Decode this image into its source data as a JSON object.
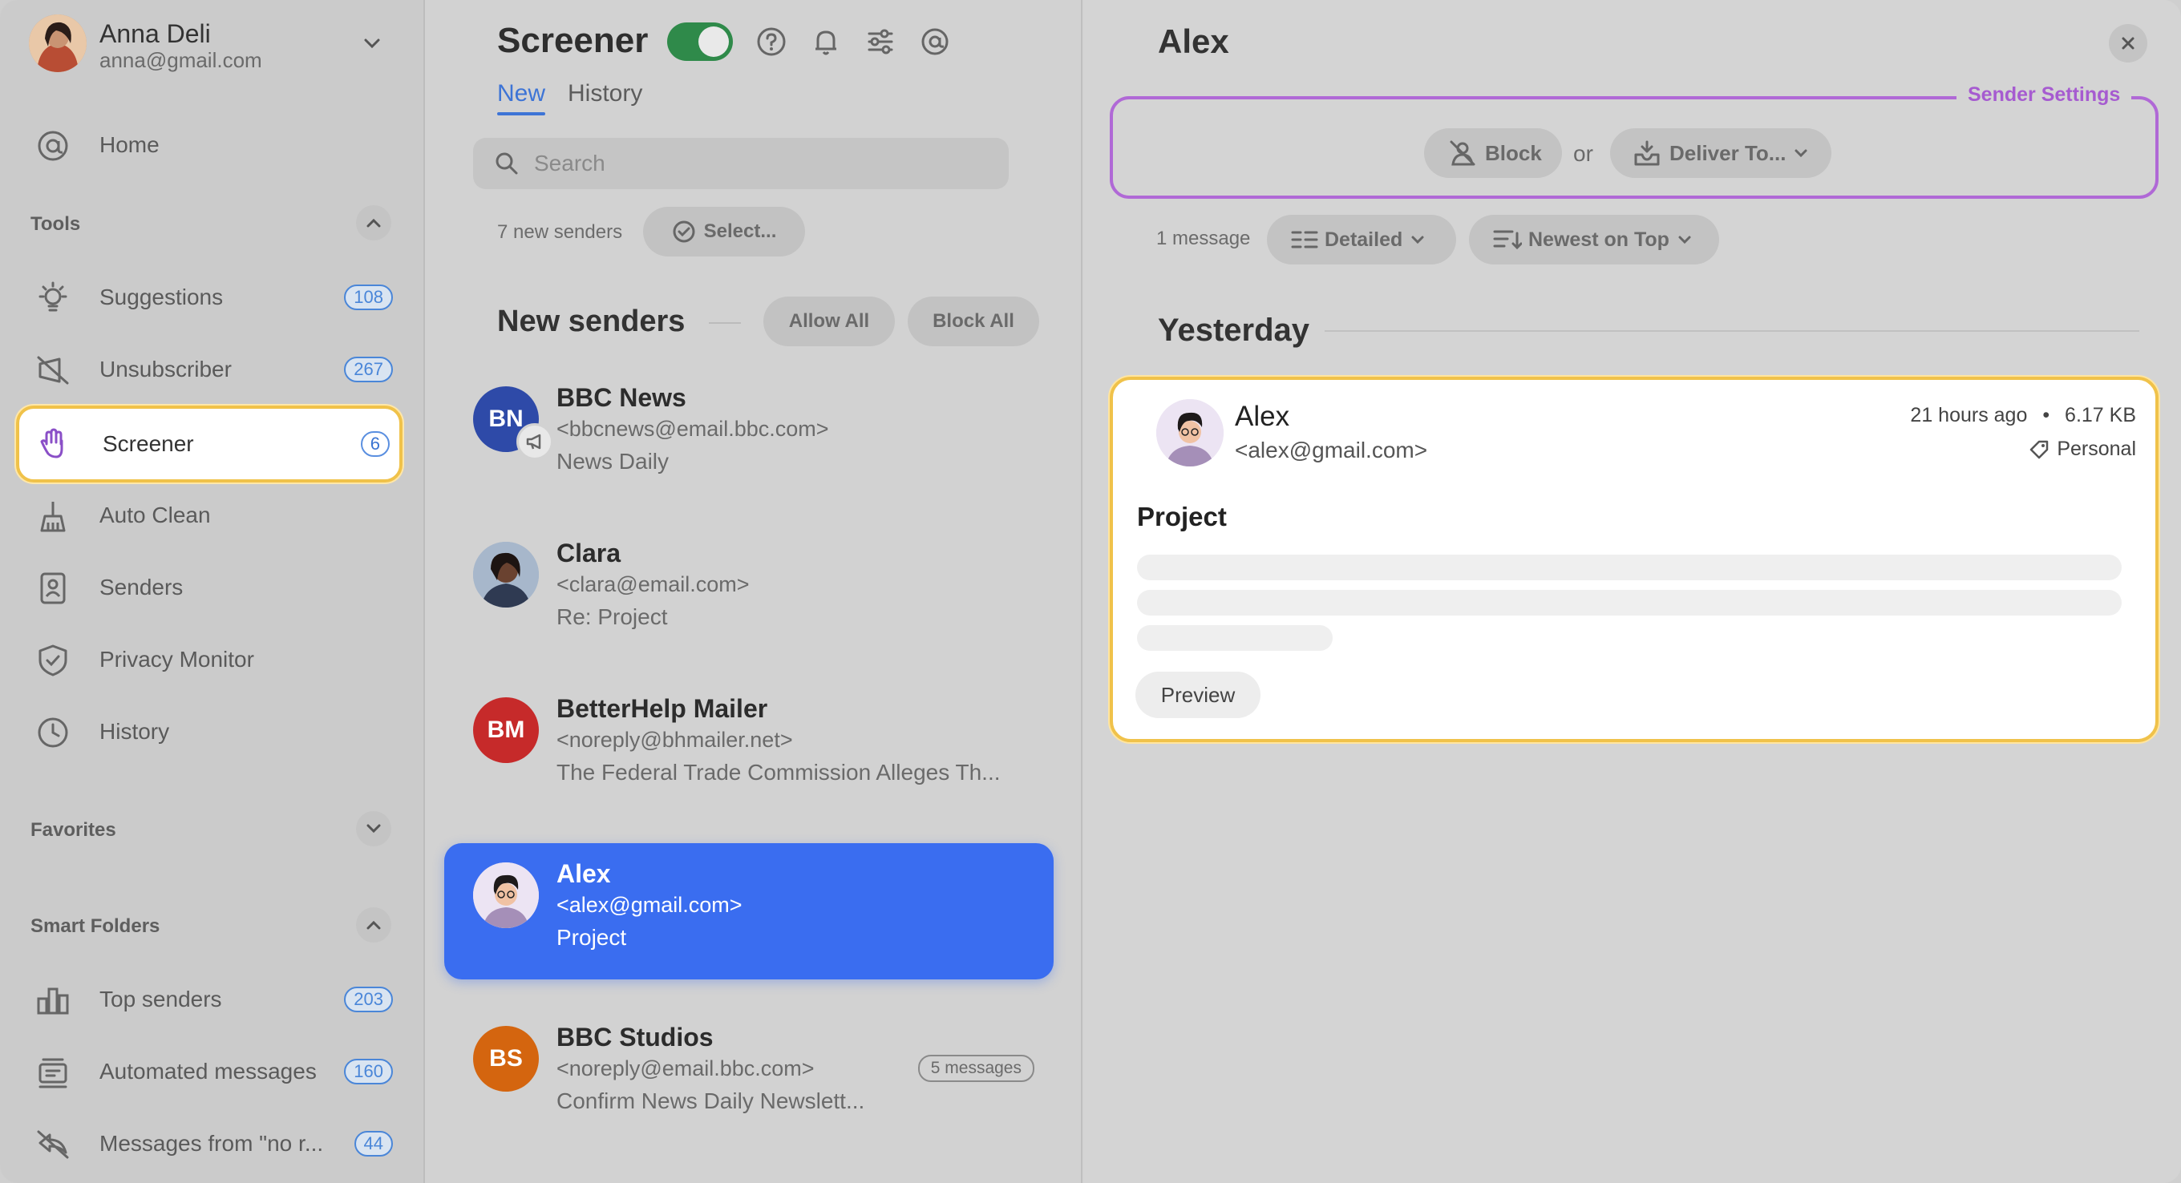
{
  "user": {
    "name": "Anna Deli",
    "email": "anna@gmail.com"
  },
  "sidebar": {
    "home": "Home",
    "tools_header": "Tools",
    "tools": [
      {
        "label": "Suggestions",
        "badge": "108",
        "icon": "lightbulb-icon"
      },
      {
        "label": "Unsubscriber",
        "badge": "267",
        "icon": "unsubscribe-icon"
      },
      {
        "label": "Screener",
        "badge": "6",
        "icon": "hand-icon"
      },
      {
        "label": "Auto Clean",
        "badge": "",
        "icon": "broom-icon"
      },
      {
        "label": "Senders",
        "badge": "",
        "icon": "contact-card-icon"
      },
      {
        "label": "Privacy Monitor",
        "badge": "",
        "icon": "shield-icon"
      },
      {
        "label": "History",
        "badge": "",
        "icon": "clock-icon"
      }
    ],
    "favorites_header": "Favorites",
    "smart_header": "Smart Folders",
    "smart": [
      {
        "label": "Top senders",
        "badge": "203",
        "icon": "bar-chart-icon"
      },
      {
        "label": "Automated messages",
        "badge": "160",
        "icon": "robot-icon"
      },
      {
        "label": "Messages from \"no r...",
        "badge": "44",
        "icon": "no-reply-icon"
      }
    ]
  },
  "screener": {
    "title": "Screener",
    "tabs": [
      "New",
      "History"
    ],
    "search_placeholder": "Search",
    "new_count": "7 new senders",
    "select_label": "Select...",
    "section_title": "New senders",
    "allow_all": "Allow All",
    "block_all": "Block All",
    "senders": [
      {
        "name": "BBC News",
        "email": "<bbcnews@email.bbc.com>",
        "subject": "News Daily",
        "initials": "BN",
        "color": "#2e4aa8",
        "badge": ""
      },
      {
        "name": "Clara",
        "email": "<clara@email.com>",
        "subject": "Re: Project",
        "initials": "",
        "color": "#2f3a52",
        "badge": ""
      },
      {
        "name": "BetterHelp Mailer",
        "email": "<noreply@bhmailer.net>",
        "subject": "The Federal Trade Commission Alleges Th...",
        "initials": "BM",
        "color": "#c62a2a",
        "badge": ""
      },
      {
        "name": "Alex",
        "email": "<alex@gmail.com>",
        "subject": "Project",
        "initials": "",
        "color": "#e6dcef",
        "badge": ""
      },
      {
        "name": "BBC Studios",
        "email": "<noreply@email.bbc.com>",
        "subject": "Confirm News Daily Newslett...",
        "initials": "BS",
        "color": "#d4650f",
        "badge": "5 messages"
      }
    ]
  },
  "detail": {
    "title": "Alex",
    "sender_settings_label": "Sender Settings",
    "block_label": "Block",
    "or_label": "or",
    "deliver_label": "Deliver To...",
    "message_count": "1 message",
    "view_mode": "Detailed",
    "sort_mode": "Newest on Top",
    "group_label": "Yesterday",
    "message": {
      "sender": "Alex",
      "email": "<alex@gmail.com>",
      "time": "21 hours ago",
      "size": "6.17 KB",
      "tag": "Personal",
      "subject": "Project",
      "preview_label": "Preview"
    }
  },
  "colors": {
    "accent": "#3a6df0",
    "highlight": "#f0c24a",
    "purple": "#b069d6",
    "toggle_on": "#2f8a4a"
  }
}
